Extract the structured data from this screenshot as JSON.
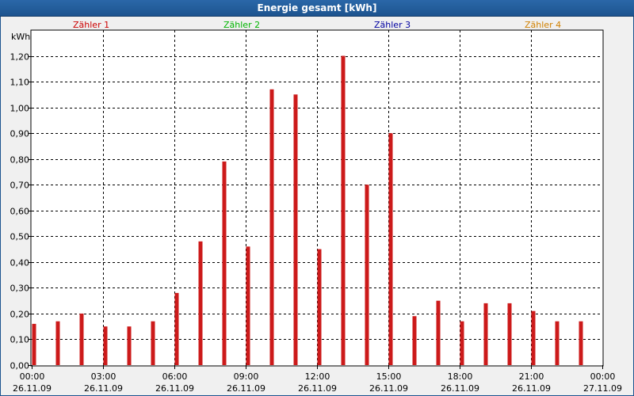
{
  "window": {
    "title": "Energie gesamt [kWh]"
  },
  "legend": [
    {
      "name": "Zähler 1",
      "color": "#cc0000"
    },
    {
      "name": "Zähler 2",
      "color": "#00b400"
    },
    {
      "name": "Zähler 3",
      "color": "#0000a0"
    },
    {
      "name": "Zähler 4",
      "color": "#d08000"
    }
  ],
  "chart_data": {
    "type": "bar",
    "ylabel": "kWh",
    "ylim": [
      0,
      1.3
    ],
    "yticks": [
      "0,00",
      "0,10",
      "0,20",
      "0,30",
      "0,40",
      "0,50",
      "0,60",
      "0,70",
      "0,80",
      "0,90",
      "1,00",
      "1,10",
      "1,20"
    ],
    "xrange_hours": [
      0,
      24
    ],
    "xticks": [
      {
        "hour": 0,
        "time": "00:00",
        "date": "26.11.09"
      },
      {
        "hour": 3,
        "time": "03:00",
        "date": "26.11.09"
      },
      {
        "hour": 6,
        "time": "06:00",
        "date": "26.11.09"
      },
      {
        "hour": 9,
        "time": "09:00",
        "date": "26.11.09"
      },
      {
        "hour": 12,
        "time": "12:00",
        "date": "26.11.09"
      },
      {
        "hour": 15,
        "time": "15:00",
        "date": "26.11.09"
      },
      {
        "hour": 18,
        "time": "18:00",
        "date": "26.11.09"
      },
      {
        "hour": 21,
        "time": "21:00",
        "date": "26.11.09"
      },
      {
        "hour": 24,
        "time": "00:00",
        "date": "27.11.09"
      }
    ],
    "series": [
      {
        "name": "Zähler 1",
        "color": "#cc1a1a",
        "hours": [
          0,
          1,
          2,
          3,
          4,
          5,
          6,
          7,
          8,
          9,
          10,
          11,
          12,
          13,
          14,
          15,
          16,
          17,
          18,
          19,
          20,
          21,
          22,
          23
        ],
        "values": [
          0.16,
          0.17,
          0.2,
          0.15,
          0.15,
          0.17,
          0.28,
          0.48,
          0.79,
          0.46,
          1.07,
          1.05,
          0.45,
          1.2,
          0.7,
          0.9,
          0.19,
          0.25,
          0.17,
          0.24,
          0.24,
          0.21,
          0.17,
          0.17
        ]
      }
    ]
  }
}
